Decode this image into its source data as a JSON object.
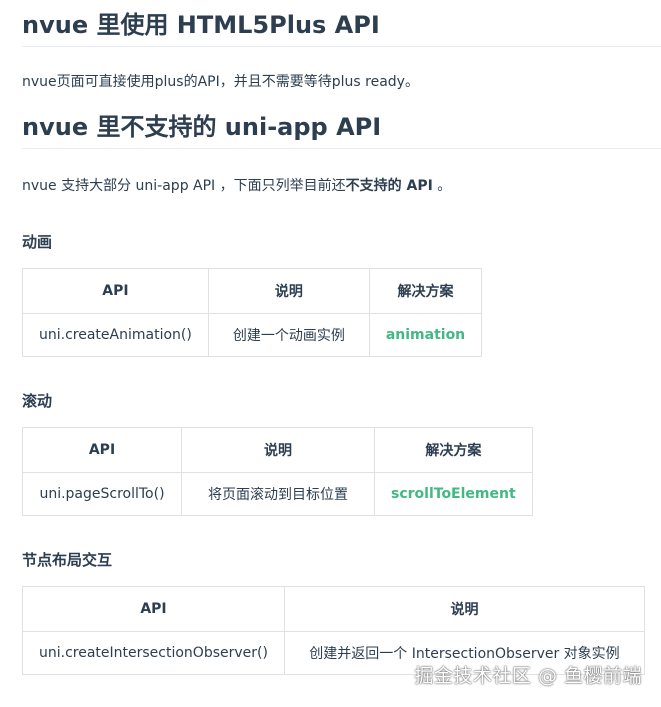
{
  "sections": {
    "html5plus": {
      "heading": "nvue 里使用 HTML5Plus API",
      "paragraph": "nvue页面可直接使用plus的API，并且不需要等待plus ready。"
    },
    "unsupported": {
      "heading": "nvue 里不支持的 uni-app API",
      "paragraph_pre": "nvue 支持大部分 uni-app API ，下面只列举目前还",
      "paragraph_bold": "不支持的 API",
      "paragraph_post": " 。"
    }
  },
  "animation": {
    "title": "动画",
    "headers": [
      "API",
      "说明",
      "解决方案"
    ],
    "row": [
      "uni.createAnimation()",
      "创建一个动画实例",
      "animation"
    ]
  },
  "scroll": {
    "title": "滚动",
    "headers": [
      "API",
      "说明",
      "解决方案"
    ],
    "row": [
      "uni.pageScrollTo()",
      "将页面滚动到目标位置",
      "scrollToElement"
    ]
  },
  "node": {
    "title": "节点布局交互",
    "headers": [
      "API",
      "说明"
    ],
    "row": [
      "uni.createIntersectionObserver()",
      "创建并返回一个 IntersectionObserver 对象实例"
    ]
  },
  "watermark": "掘金技术社区 @ 鱼樱前端",
  "colors": {
    "text": "#2c3e50",
    "link": "#42b983",
    "border": "#dfe2e5"
  }
}
